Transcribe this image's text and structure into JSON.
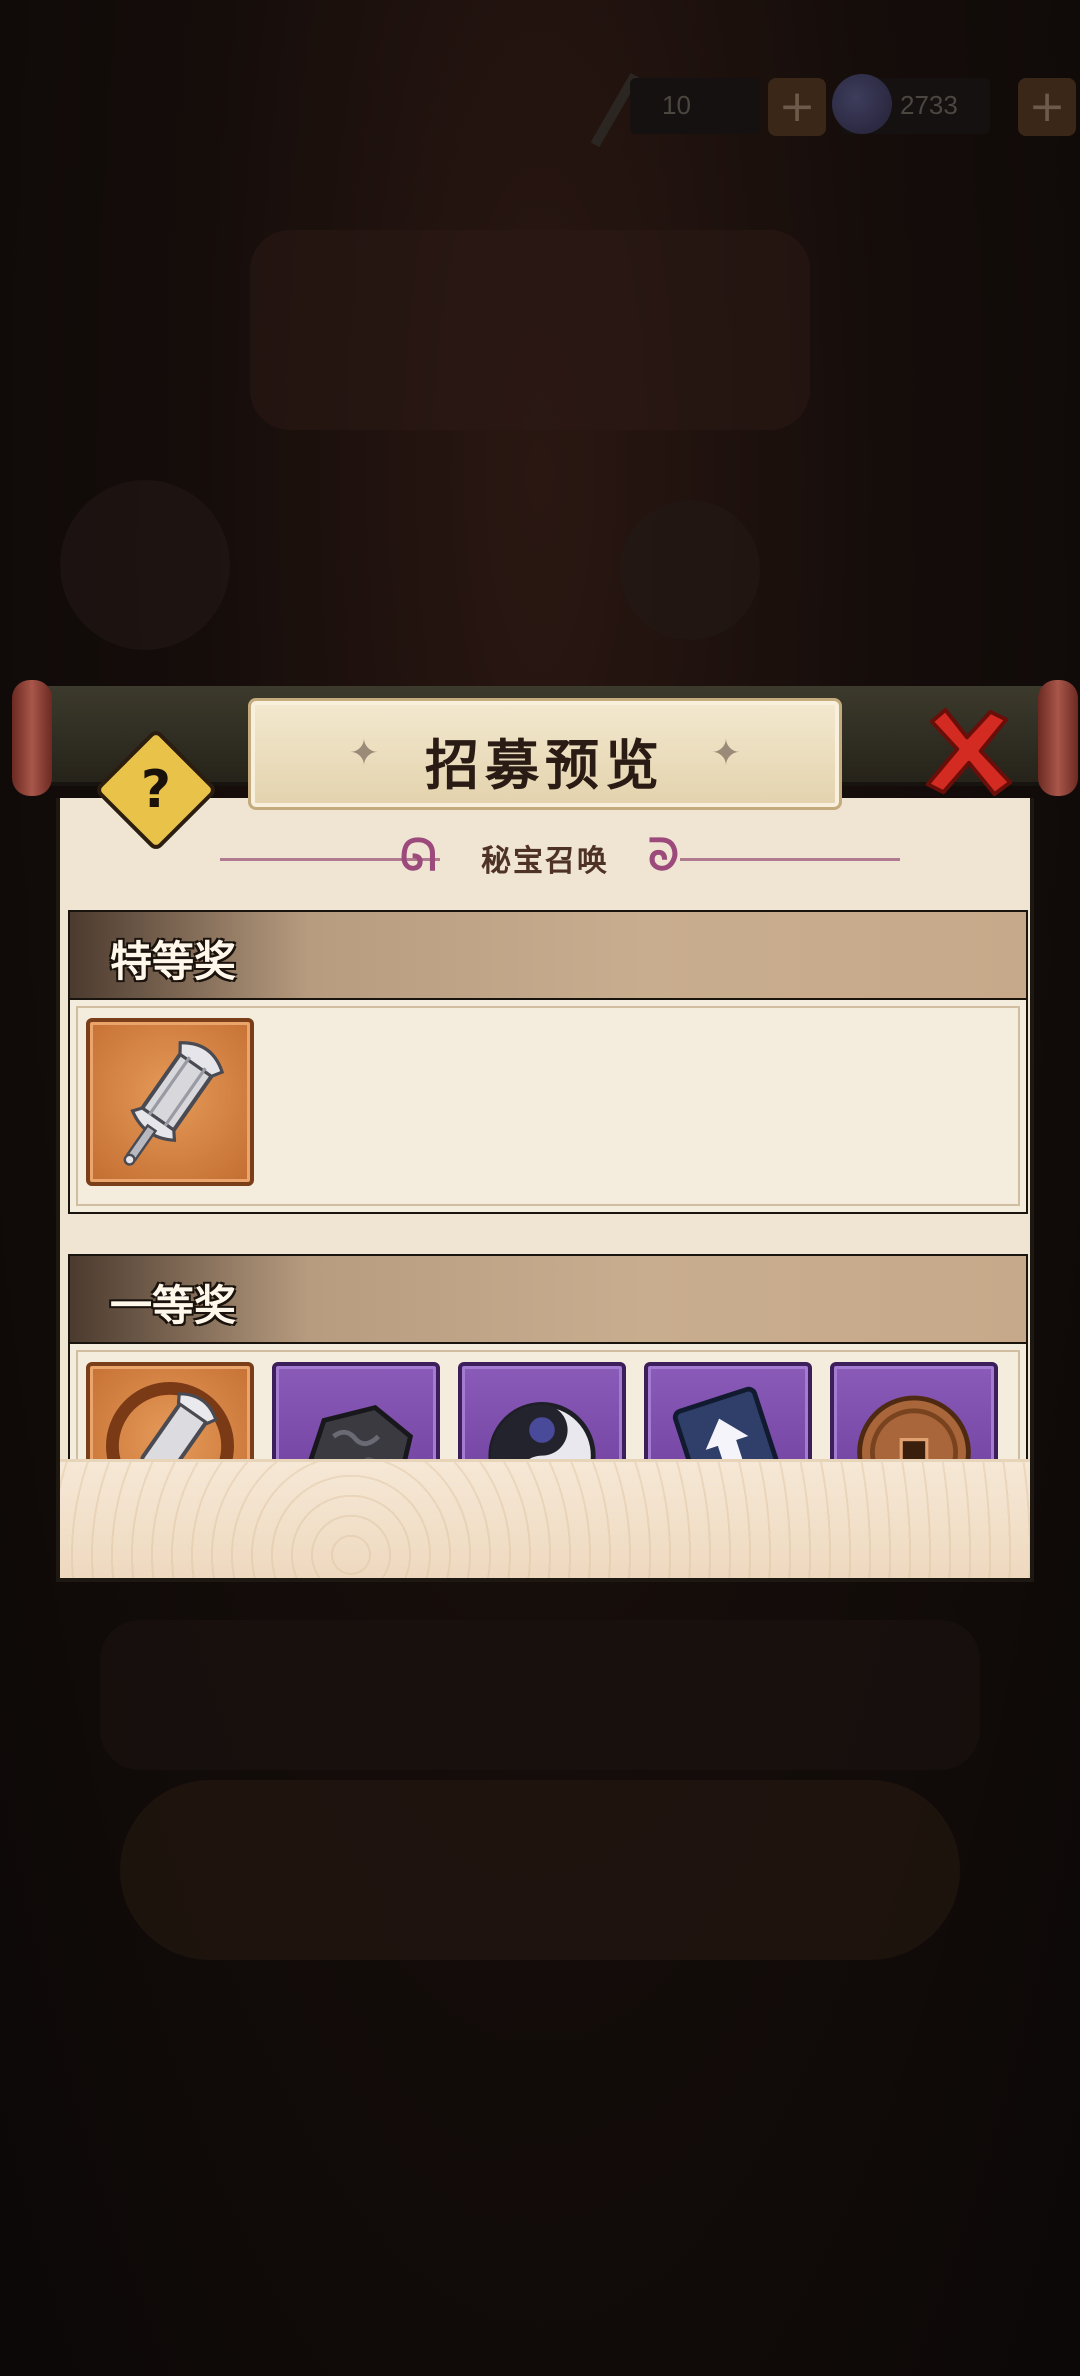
{
  "resources": {
    "scroll_count": "10",
    "gems": "2733"
  },
  "dialog": {
    "title": "招募预览",
    "subtitle": "秘宝召唤",
    "help_glyph": "?",
    "tiers": [
      {
        "label": "特等奖",
        "items": [
          {
            "icon": "silver-scroll-weapon-icon",
            "rarity": "orange"
          }
        ]
      },
      {
        "label": "一等奖",
        "items": [
          {
            "icon": "scroll-weapon-fragment-icon",
            "rarity": "orange"
          },
          {
            "icon": "black-ore-icon",
            "rarity": "purple"
          },
          {
            "icon": "yin-yang-orb-icon",
            "rarity": "purple"
          },
          {
            "icon": "upgrade-book-icon",
            "rarity": "purple"
          },
          {
            "icon": "copper-coin-icon",
            "rarity": "purple"
          }
        ]
      }
    ]
  },
  "colors": {
    "gold_rarity": "#c36d31",
    "purple_rarity": "#6a3a98",
    "close_red": "#d32a22",
    "help_yellow": "#e9c349"
  }
}
